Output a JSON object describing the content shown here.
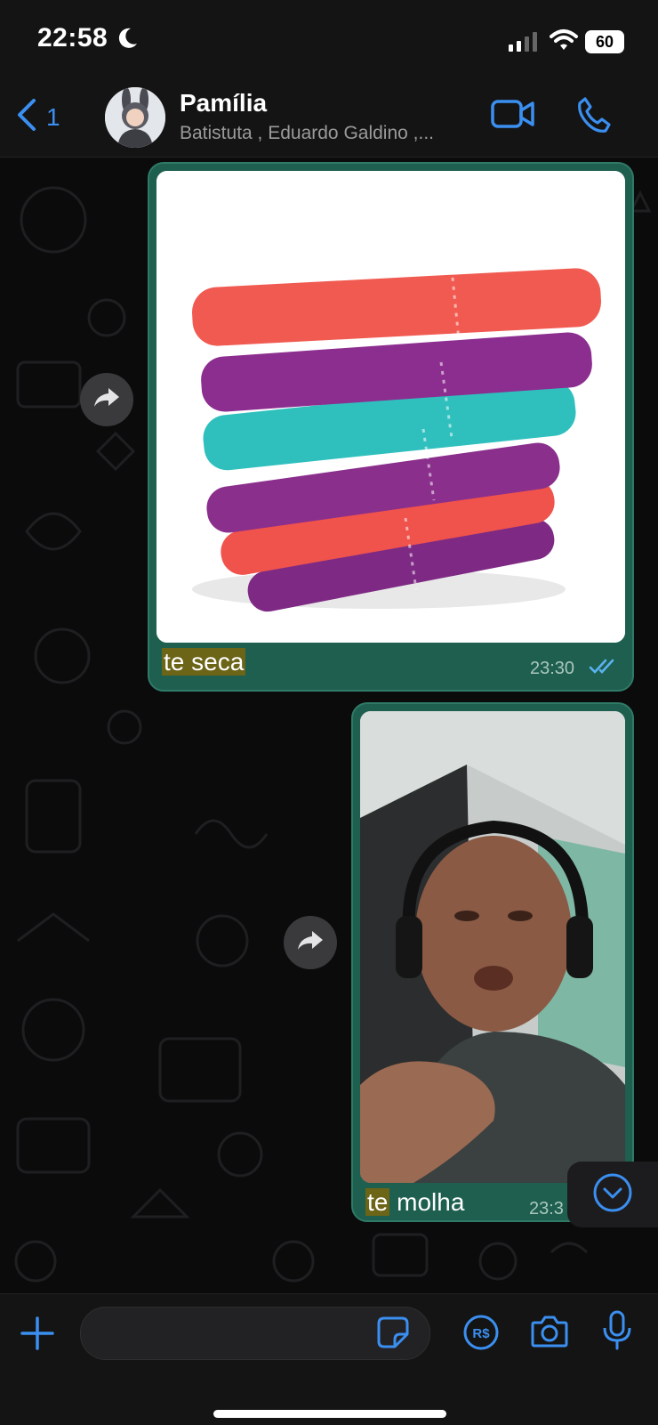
{
  "status_bar": {
    "time": "22:58",
    "battery": "60"
  },
  "header": {
    "back_count": "1",
    "group_name": "Pamília",
    "members": "Batistuta , Eduardo Galdino ,..."
  },
  "messages": [
    {
      "type": "image",
      "image_desc": "stack of colorful folded towels",
      "caption_highlight": "te seca",
      "caption_rest": "",
      "time": "23:30",
      "read": true
    },
    {
      "type": "image",
      "image_desc": "man with headphones blowing a kiss",
      "caption_highlight": "te",
      "caption_rest": " molha",
      "time": "23:3"
    }
  ],
  "colors": {
    "accent": "#3b8ff0",
    "outgoing_bubble": "#1f5f4f",
    "highlight": "#6c6417"
  },
  "icons": [
    "moon-icon",
    "signal-icon",
    "wifi-icon",
    "back-chevron-icon",
    "video-call-icon",
    "phone-icon",
    "forward-icon",
    "chevron-down-icon",
    "plus-icon",
    "sticker-icon",
    "pix-icon",
    "camera-icon",
    "mic-icon"
  ]
}
